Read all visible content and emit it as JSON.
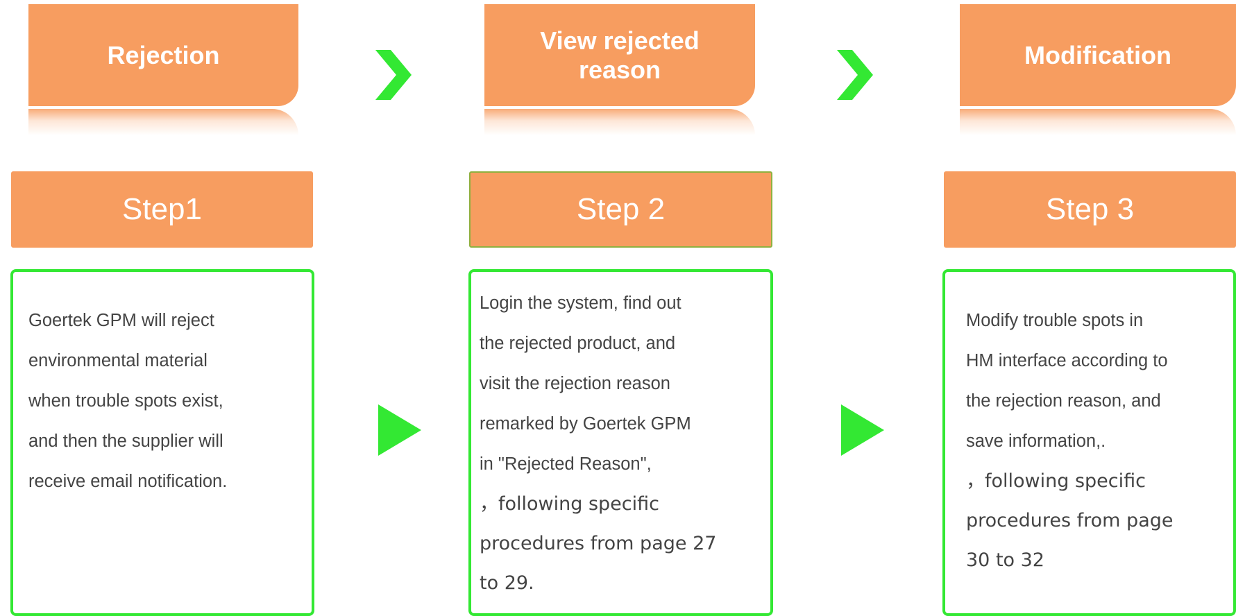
{
  "colors": {
    "tab": "#f79d60",
    "step": "#f79d60",
    "outline": "#33e833",
    "arrow": "#33e833",
    "text": "#444444"
  },
  "stages": [
    {
      "tab_title": "Rejection",
      "step_label": "Step1",
      "description": [
        "Goertek GPM will reject",
        "environmental material",
        "when trouble spots  exist,",
        "and then the supplier will",
        "receive email notification."
      ],
      "extra": []
    },
    {
      "tab_title": "View rejected reason",
      "step_label": "Step 2",
      "description": [
        "Login the system, find out",
        "the rejected product, and",
        "visit the rejection reason",
        "remarked by Goertek GPM",
        "in \"Rejected Reason\","
      ],
      "extra": [
        "，following specific",
        "procedures from page 27",
        "to 29."
      ]
    },
    {
      "tab_title": "Modification",
      "step_label": "Step 3",
      "description": [
        "Modify trouble spots in",
        "HM interface according to",
        "the rejection reason, and",
        "save information,."
      ],
      "extra": [
        "，following specific",
        "procedures from page",
        "30 to 32"
      ]
    }
  ],
  "arrows": {
    "top_icon": "chevron-right-icon",
    "middle_icon": "play-arrow-icon"
  }
}
